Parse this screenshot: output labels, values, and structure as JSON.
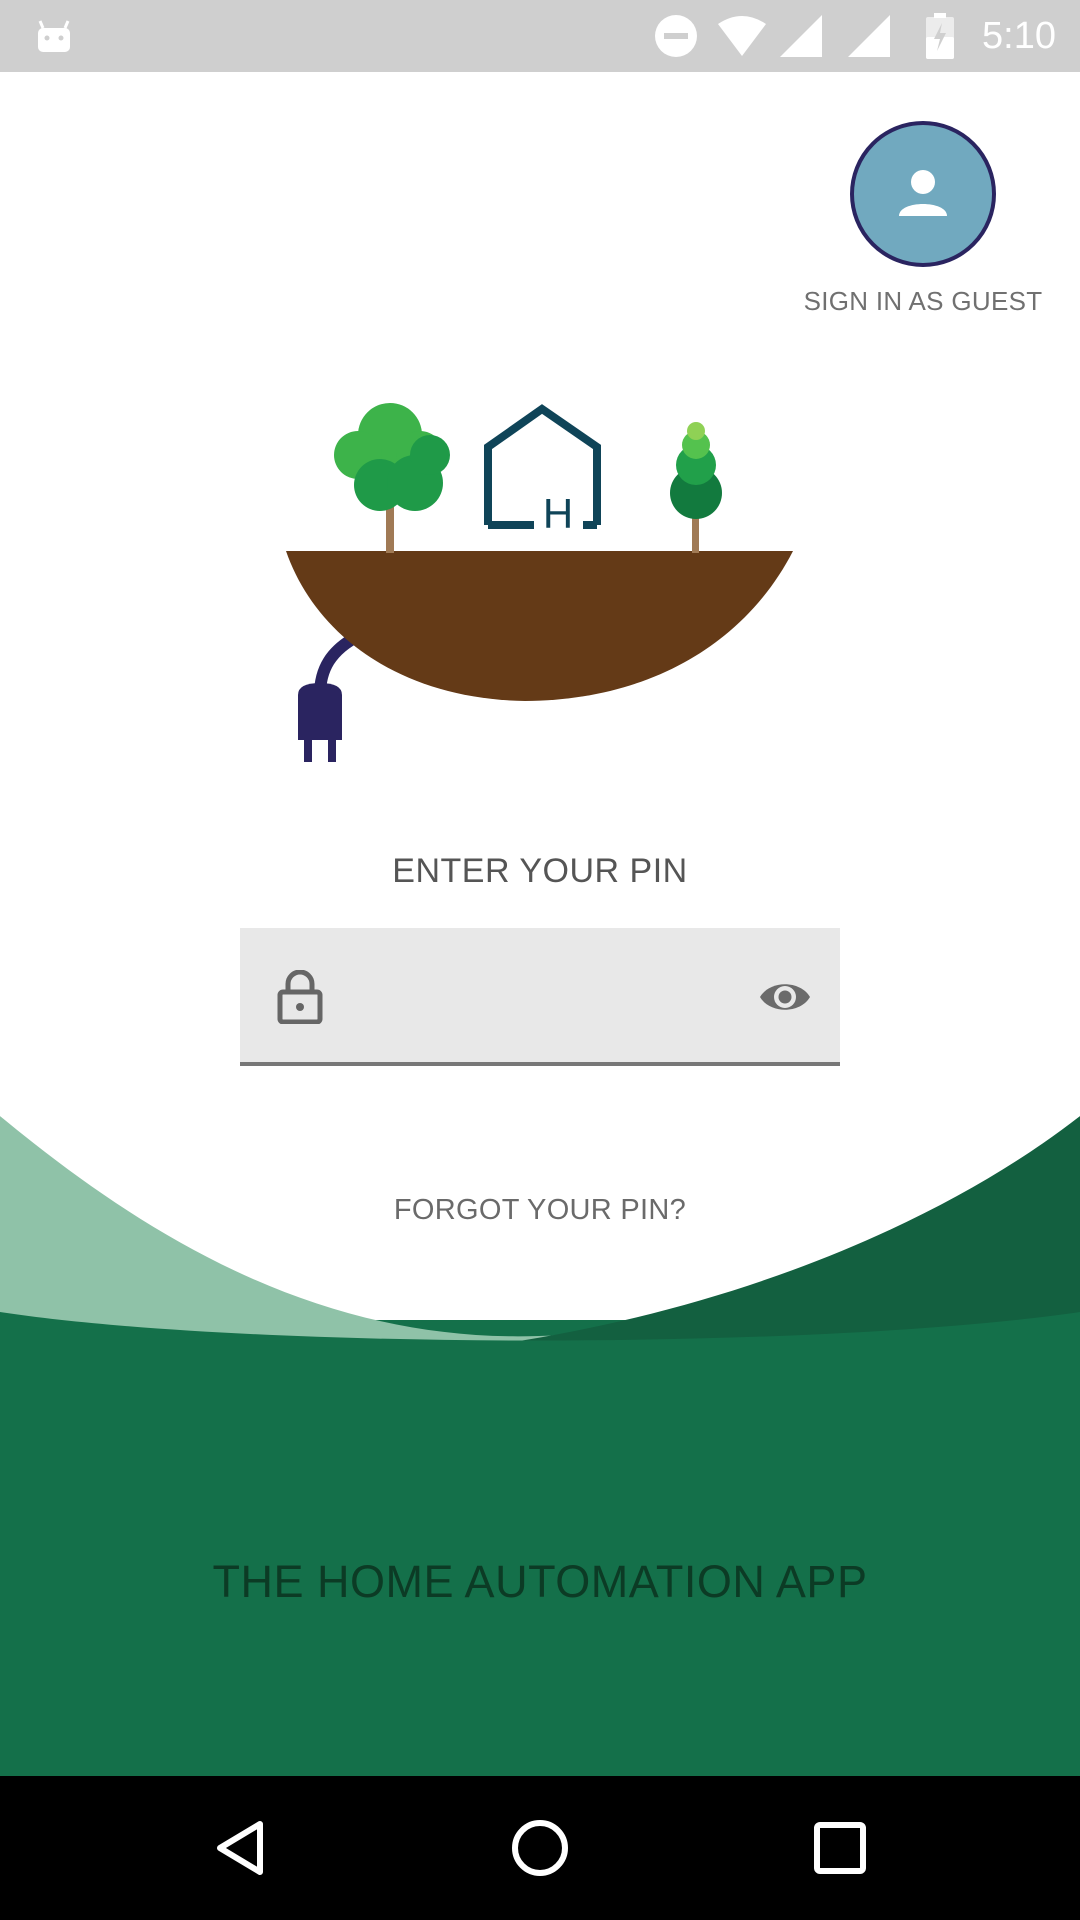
{
  "status_bar": {
    "time": "5:10",
    "icons": [
      "android-debug-icon",
      "do-not-disturb-icon",
      "wifi-icon",
      "signal-icon",
      "signal-icon",
      "battery-charging-icon"
    ]
  },
  "guest": {
    "label": "SIGN IN AS GUEST",
    "icon": "person-icon"
  },
  "pin": {
    "heading": "ENTER YOUR PIN",
    "value": "",
    "placeholder": "",
    "lock_icon": "lock-icon",
    "visibility_icon": "eye-icon"
  },
  "forgot_label": "FORGOT YOUR PIN?",
  "app_title": "THE HOME AUTOMATION APP",
  "colors": {
    "status_bar": "#cfcfcf",
    "guest_avatar": "#71a9bf",
    "guest_border": "#2a2460",
    "wave_light": "#8fc2a8",
    "wave_dark": "#136040",
    "wave_main": "#14704a",
    "soil": "#643a17",
    "plug": "#2a2460",
    "house": "#0f4458"
  },
  "nav_bar": {
    "buttons": [
      "back-icon",
      "home-icon",
      "recents-icon"
    ]
  }
}
